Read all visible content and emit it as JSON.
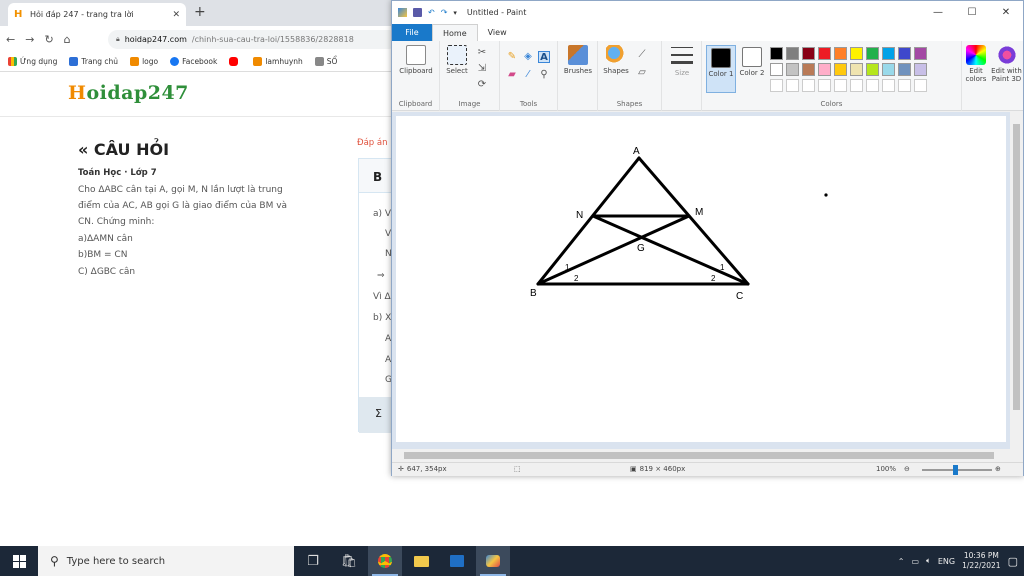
{
  "browser": {
    "tab_title": "Hỏi đáp 247 - trang tra lời",
    "tab_favicon": "H",
    "new_tab_symbol": "+",
    "close_symbol": "✕",
    "address_host": "hoidap247.com",
    "address_path": "/chinh-sua-cau-tra-loi/1558836/2828818",
    "bookmarks": [
      "Ứng dụng",
      "Trang chủ",
      "logo",
      "Facebook",
      "",
      "lamhuynh",
      "SỔ"
    ]
  },
  "site": {
    "logo_h": "H",
    "logo_rest": "oidap247",
    "question_title": "CÂU HỎI",
    "question_title_icon": "«",
    "subject": "Toán Học · Lớp 7",
    "question_lines": [
      "Cho ΔABC cân tại A, gọi M, N lần lượt là trung",
      "điểm của AC, AB gọi G là giao điểm của BM và",
      "CN. Chứng minh:",
      "a)ΔAMN cân",
      "b)BM = CN",
      "C) ΔGBC cân"
    ],
    "answer_tab": "Đáp án",
    "answer_toolbar_label": "B",
    "answer_lines": [
      "a) V",
      "V",
      "N",
      "⇒",
      "Vì Δ",
      "b) X",
      "A",
      "A",
      "G"
    ],
    "answer_footer_icon": "Σ"
  },
  "paint": {
    "title": "Untitled - Paint",
    "window_controls": [
      "—",
      "☐",
      "✕"
    ],
    "tabs": {
      "file": "File",
      "home": "Home",
      "view": "View"
    },
    "groups": {
      "clipboard": "Clipboard",
      "image": "Image",
      "tools": "Tools",
      "shapes": "Shapes",
      "colors": "Colors"
    },
    "buttons": {
      "clipboard": "Clipboard",
      "select": "Select",
      "brushes": "Brushes",
      "shapes": "Shapes",
      "size": "Size",
      "color1": "Color 1",
      "color2": "Color 2",
      "edit_colors": "Edit colors",
      "edit_paint3d": "Edit with Paint 3D"
    },
    "palette_row1": [
      "#000000",
      "#7f7f7f",
      "#880015",
      "#ed1c24",
      "#ff7f27",
      "#fff200",
      "#22b14c",
      "#00a2e8",
      "#3f48cc",
      "#a349a4"
    ],
    "palette_row2": [
      "#ffffff",
      "#c3c3c3",
      "#b97a57",
      "#ffaec9",
      "#ffc90e",
      "#efe4b0",
      "#b5e61d",
      "#99d9ea",
      "#7092be",
      "#c8bfe7"
    ],
    "drawing_labels": {
      "A": "A",
      "B": "B",
      "C": "C",
      "M": "M",
      "N": "N",
      "G": "G",
      "angle_b1": "1",
      "angle_b2": "2",
      "angle_c1": "1",
      "angle_c2": "2"
    },
    "status": {
      "cursor_pos": "647, 354px",
      "canvas_size": "819 × 460px",
      "zoom": "100%"
    }
  },
  "taskbar": {
    "search_placeholder": "Type here to search",
    "language": "ENG",
    "time": "10:36 PM",
    "date": "1/22/2021"
  }
}
